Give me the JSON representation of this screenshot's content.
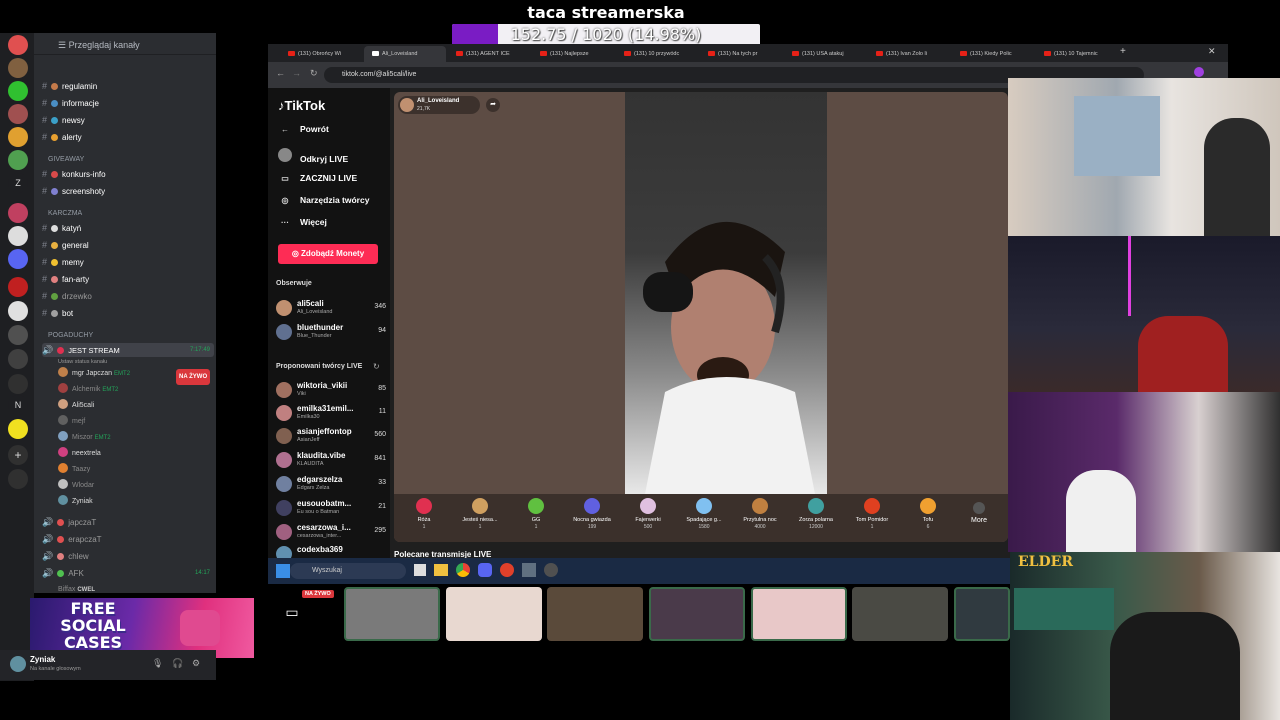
{
  "goal": {
    "title": "taca streamerska",
    "progress_text": "152.75 / 1020 (14.98%)",
    "fraction": 0.1498
  },
  "discord": {
    "browse_label": "Przeglądaj kanały",
    "channels_top": [
      {
        "label": "regulamin",
        "color": "#c47a4a"
      },
      {
        "label": "informacje",
        "color": "#4a8ec4"
      },
      {
        "label": "newsy",
        "color": "#3ba0c8"
      },
      {
        "label": "alerty",
        "color": "#e8a030"
      }
    ],
    "cat_giveaway": "GIVEAWAY",
    "channels_giveaway": [
      {
        "label": "konkurs-info",
        "color": "#d84a4a"
      },
      {
        "label": "screenshoty",
        "color": "#8080d0"
      }
    ],
    "cat_karczma": "KARCZMA",
    "channels_karczma": [
      {
        "label": "katyń",
        "color": "#ddd"
      },
      {
        "label": "general",
        "color": "#e8b040"
      },
      {
        "label": "memy",
        "color": "#f0c030"
      },
      {
        "label": "fan-arty",
        "color": "#e08080"
      },
      {
        "label": "drzewko",
        "color": "#60a040"
      },
      {
        "label": "bot",
        "color": "#a0a0a0"
      }
    ],
    "cat_pogaduchy": "POGADUCHY",
    "voice_main": {
      "label": "JEST STREAM",
      "time": "7:17:49",
      "status": "Ustaw status kanału"
    },
    "voice_users": [
      {
        "name": "mgr Japczan",
        "tag": "EMT2",
        "live": "NA ŻYWO",
        "color": "#c0804a"
      },
      {
        "name": "Alchemik",
        "tag": "EMT2",
        "live": "",
        "color": "#a04040"
      },
      {
        "name": "Ali5cali",
        "tag": "",
        "live": "",
        "color": "#d0a080"
      },
      {
        "name": "mejf",
        "tag": "",
        "live": "",
        "color": "#606060"
      },
      {
        "name": "Miszor",
        "tag": "EMT2",
        "live": "",
        "color": "#80a0c0"
      },
      {
        "name": "neextrela",
        "tag": "",
        "live": "",
        "color": "#d04080"
      },
      {
        "name": "Taazy",
        "tag": "",
        "live": "",
        "color": "#e08030"
      },
      {
        "name": "Wlodar",
        "tag": "",
        "live": "",
        "color": "#c0c0c0"
      },
      {
        "name": "Zyniak",
        "tag": "",
        "live": "",
        "color": "#6090a0"
      }
    ],
    "voice_more": [
      {
        "label": "japczaT",
        "color": "#e05050",
        "time": ""
      },
      {
        "label": "erapczaT",
        "color": "#e05050",
        "time": ""
      },
      {
        "label": "chlew",
        "color": "#e08080",
        "time": ""
      },
      {
        "label": "AFK",
        "color": "#50c050",
        "time": "14:17"
      }
    ],
    "biffax": "Biffax",
    "cwel": "CWEL",
    "ad_text": "FREE SOCIAL CASES",
    "user": {
      "name": "Zyniak",
      "status": "Na kanale głosowym"
    },
    "rail_badges": [
      "2",
      "Z",
      "N"
    ]
  },
  "browser": {
    "tabs": [
      "(131) Obrońcy Wi",
      "Ali_Loveisland",
      "(131) AGENT ICE",
      "(131) Najlepsze",
      "(131) 10 przywódc",
      "(131) Na tych pr",
      "(131) USA atakuj",
      "(131) Ivan Zolo li",
      "(131) Kiedy Polic",
      "(131) 10 Tajemnic"
    ],
    "url": "tiktok.com/@ali5cali/live"
  },
  "tiktok": {
    "logo": "TikTok",
    "back": "Powrót",
    "nav": [
      "Odkryj LIVE",
      "ZACZNIJ LIVE",
      "Narzędzia twórcy",
      "Więcej"
    ],
    "coins_button": "Zdobądź Monety",
    "following_header": "Obserwuje",
    "following": [
      {
        "name": "ali5cali",
        "sub": "Ali_Loveisland",
        "count": "346",
        "color": "#c09070"
      },
      {
        "name": "bluethunder",
        "sub": "Blue_Thunder",
        "count": "94",
        "color": "#607090"
      }
    ],
    "suggested_header": "Proponowani twórcy LIVE",
    "suggested": [
      {
        "name": "wiktoria_vikii",
        "sub": "Viki",
        "count": "85",
        "color": "#a07060"
      },
      {
        "name": "emilka31emil...",
        "sub": "Emilka30",
        "count": "11",
        "color": "#c08080"
      },
      {
        "name": "asianjeffontop",
        "sub": "AsianJeff",
        "count": "560",
        "color": "#806050"
      },
      {
        "name": "klaudita.vibe",
        "sub": "KLAUDITA",
        "count": "841",
        "color": "#b07090"
      },
      {
        "name": "edgarszelza",
        "sub": "Edgars Zelza",
        "count": "33",
        "color": "#7080a0"
      },
      {
        "name": "eusouobatm...",
        "sub": "Eu sou o Batman",
        "count": "21",
        "color": "#404060"
      },
      {
        "name": "cesarzowa_i...",
        "sub": "cesarzowa_inter...",
        "count": "295",
        "color": "#a06080"
      },
      {
        "name": "codexba369",
        "sub": "",
        "count": "",
        "color": "#6090b0"
      }
    ],
    "streamer": {
      "name": "Ali_Loveisland",
      "likes": "21,7K"
    },
    "gifts": [
      {
        "label": "Róża",
        "price": "1",
        "color": "#e03050"
      },
      {
        "label": "Jesteś niesa...",
        "price": "1",
        "color": "#d0a060"
      },
      {
        "label": "GG",
        "price": "1",
        "color": "#60c040"
      },
      {
        "label": "Nocna gwiazda",
        "price": "199",
        "color": "#6060e0"
      },
      {
        "label": "Fajerwerki",
        "price": "500",
        "color": "#e0c0e0"
      },
      {
        "label": "Spadające g...",
        "price": "1580",
        "color": "#80c0f0"
      },
      {
        "label": "Przytulna noc",
        "price": "4000",
        "color": "#c08040"
      },
      {
        "label": "Zorza polarna",
        "price": "12000",
        "color": "#40a0a0"
      },
      {
        "label": "Tom Pomidor",
        "price": "1",
        "color": "#e04020"
      },
      {
        "label": "Tofu",
        "price": "6",
        "color": "#f0a030"
      }
    ],
    "more": "More",
    "recommended": "Polecane transmisje LIVE"
  },
  "taskbar": {
    "search_placeholder": "Wyszukaj",
    "live_badge": "NA ŻYWO"
  },
  "webcam_labels": {
    "elder": "ELDER"
  }
}
